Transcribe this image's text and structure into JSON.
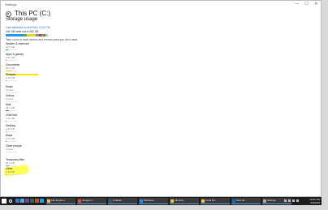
{
  "window": {
    "app_name": "Settings",
    "minimize": "—",
    "maximize": "☐",
    "close": "✕"
  },
  "header": {
    "icon": "gear-icon",
    "title": "This PC (C:)"
  },
  "storage": {
    "heading": "Storage usage",
    "refreshed": "Last refreshed on 6/4/2016 12:01 PM",
    "used": "444 GB used out of 452 GB",
    "instruction": "Take a look in each section and remove what you don't need.",
    "usage_fraction": 0.98,
    "bar_colors": [
      "#2196f3",
      "#4caf50",
      "#e6d22a",
      "#8c8c8c",
      "#8e44ad",
      "#e0782a",
      "#3f8f55",
      "#c8c8c8"
    ],
    "categories": [
      {
        "name": "System & reserved",
        "size": "16.0 GB",
        "color": "#2196f3",
        "fraction": 0.18
      },
      {
        "name": "Apps & games",
        "size": "4.41 GB",
        "color": "#4caf50",
        "fraction": 0.06
      },
      {
        "name": "Documents",
        "size": "80.5 GB",
        "color": "#e6d22a",
        "fraction": 0.55
      },
      {
        "name": "Pictures",
        "size": "1.30 GB",
        "color": "#8c8c8c",
        "fraction": 0.02
      },
      {
        "name": "Music",
        "size": "0 bytes",
        "color": "#8c8c8c",
        "fraction": 0
      },
      {
        "name": "Videos",
        "size": "0 bytes",
        "color": "#8c8c8c",
        "fraction": 0
      },
      {
        "name": "Mail",
        "size": "28.1 GB",
        "color": "#8e44ad",
        "fraction": 0.3
      },
      {
        "name": "OneDrive",
        "size": "1.41 GB",
        "color": "#8c8c8c",
        "fraction": 0.02
      },
      {
        "name": "Desktop",
        "size": "4.60 GB",
        "color": "#e0782a",
        "fraction": 0.06
      },
      {
        "name": "Maps",
        "size": "1.01 GB",
        "color": "#3f8f55",
        "fraction": 0.02
      },
      {
        "name": "Other people",
        "size": "0 bytes",
        "color": "#8c8c8c",
        "fraction": 0
      },
      {
        "name": "Temporary files",
        "size": "28.1 GB",
        "color": "#8c8c8c",
        "fraction": 0.3
      },
      {
        "name": "Other",
        "size": "1.36 GB",
        "color": "#8c8c8c",
        "fraction": 0.02
      }
    ]
  },
  "taskbar": {
    "apps": [
      {
        "label": "File Explorer",
        "icon": "folder-icon",
        "color": "#f2c14e"
      },
      {
        "label": "Google C...",
        "icon": "chrome-icon",
        "color": "#e74c3c"
      },
      {
        "label": "Untitled...",
        "icon": "word-icon",
        "color": "#2b5797"
      },
      {
        "label": "Windows...",
        "icon": "app-icon",
        "color": "#1e90ff"
      },
      {
        "label": "File Exp...",
        "icon": "folder-icon",
        "color": "#f2c14e"
      },
      {
        "label": "Local Bu...",
        "icon": "folder-icon",
        "color": "#f2c14e"
      },
      {
        "label": "Sent Ite...",
        "icon": "outlook-icon",
        "color": "#0072c6"
      },
      {
        "label": "Settings",
        "icon": "gear-icon",
        "color": "#aaaaaa"
      }
    ],
    "pinned_icons": [
      {
        "icon": "edge-icon",
        "color": "#2f7fd8"
      },
      {
        "icon": "store-icon",
        "color": "#5aa7e0"
      },
      {
        "icon": "onenote-icon",
        "color": "#7b3f9e"
      },
      {
        "icon": "excel-icon",
        "color": "#1e7145"
      },
      {
        "icon": "powerpoint-icon",
        "color": "#d24726"
      },
      {
        "icon": "skype-icon",
        "color": "#00aff0"
      }
    ],
    "time": "12:01 PM",
    "date": "6/4/2016"
  },
  "highlight_color": "#ffff3a"
}
